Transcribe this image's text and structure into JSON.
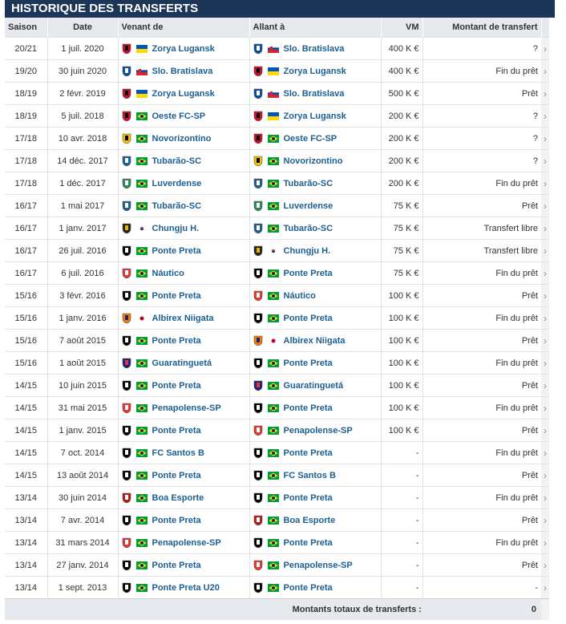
{
  "section": {
    "title": "Historique des transferts"
  },
  "columns": {
    "season": "Saison",
    "date": "Date",
    "from": "Venant de",
    "to": "Allant à",
    "vm": "VM",
    "fee": "Montant de transfert"
  },
  "rows": [
    {
      "season": "20/21",
      "date": "1 juil. 2020",
      "from": "Zorya Lugansk",
      "from_flag": "ua",
      "to": "Slo. Bratislava",
      "to_flag": "sk",
      "vm": "400 K €",
      "fee": "?"
    },
    {
      "season": "19/20",
      "date": "30 juin 2020",
      "from": "Slo. Bratislava",
      "from_flag": "sk",
      "to": "Zorya Lugansk",
      "to_flag": "ua",
      "vm": "400 K €",
      "fee": "Fin du prêt"
    },
    {
      "season": "18/19",
      "date": "2 févr. 2019",
      "from": "Zorya Lugansk",
      "from_flag": "ua",
      "to": "Slo. Bratislava",
      "to_flag": "sk",
      "vm": "500 K €",
      "fee": "Prêt"
    },
    {
      "season": "18/19",
      "date": "5 juil. 2018",
      "from": "Oeste FC-SP",
      "from_flag": "br",
      "to": "Zorya Lugansk",
      "to_flag": "ua",
      "vm": "200 K €",
      "fee": "?"
    },
    {
      "season": "17/18",
      "date": "10 avr. 2018",
      "from": "Novorizontino",
      "from_flag": "br",
      "to": "Oeste FC-SP",
      "to_flag": "br",
      "vm": "200 K €",
      "fee": "?"
    },
    {
      "season": "17/18",
      "date": "14 déc. 2017",
      "from": "Tubarão-SC",
      "from_flag": "br",
      "to": "Novorizontino",
      "to_flag": "br",
      "vm": "200 K €",
      "fee": "?"
    },
    {
      "season": "17/18",
      "date": "1 déc. 2017",
      "from": "Luverdense",
      "from_flag": "br",
      "to": "Tubarão-SC",
      "to_flag": "br",
      "vm": "200 K €",
      "fee": "Fin du prêt"
    },
    {
      "season": "16/17",
      "date": "1 mai 2017",
      "from": "Tubarão-SC",
      "from_flag": "br",
      "to": "Luverdense",
      "to_flag": "br",
      "vm": "75 K €",
      "fee": "Prêt"
    },
    {
      "season": "16/17",
      "date": "1 janv. 2017",
      "from": "Chungju H.",
      "from_flag": "kr",
      "to": "Tubarão-SC",
      "to_flag": "br",
      "vm": "75 K €",
      "fee": "Transfert libre"
    },
    {
      "season": "16/17",
      "date": "26 juil. 2016",
      "from": "Ponte Preta",
      "from_flag": "br",
      "to": "Chungju H.",
      "to_flag": "kr",
      "vm": "75 K €",
      "fee": "Transfert libre"
    },
    {
      "season": "16/17",
      "date": "6 juil. 2016",
      "from": "Náutico",
      "from_flag": "br",
      "to": "Ponte Preta",
      "to_flag": "br",
      "vm": "75 K €",
      "fee": "Fin du prêt"
    },
    {
      "season": "15/16",
      "date": "3 févr. 2016",
      "from": "Ponte Preta",
      "from_flag": "br",
      "to": "Náutico",
      "to_flag": "br",
      "vm": "100 K €",
      "fee": "Prêt"
    },
    {
      "season": "15/16",
      "date": "1 janv. 2016",
      "from": "Albirex Niigata",
      "from_flag": "jp",
      "to": "Ponte Preta",
      "to_flag": "br",
      "vm": "100 K €",
      "fee": "Fin du prêt"
    },
    {
      "season": "15/16",
      "date": "7 août 2015",
      "from": "Ponte Preta",
      "from_flag": "br",
      "to": "Albirex Niigata",
      "to_flag": "jp",
      "vm": "100 K €",
      "fee": "Prêt"
    },
    {
      "season": "15/16",
      "date": "1 août 2015",
      "from": "Guaratinguetá",
      "from_flag": "br",
      "to": "Ponte Preta",
      "to_flag": "br",
      "vm": "100 K €",
      "fee": "Fin du prêt"
    },
    {
      "season": "14/15",
      "date": "10 juin 2015",
      "from": "Ponte Preta",
      "from_flag": "br",
      "to": "Guaratinguetá",
      "to_flag": "br",
      "vm": "100 K €",
      "fee": "Prêt"
    },
    {
      "season": "14/15",
      "date": "31 mai 2015",
      "from": "Penapolense-SP",
      "from_flag": "br",
      "to": "Ponte Preta",
      "to_flag": "br",
      "vm": "100 K €",
      "fee": "Fin du prêt"
    },
    {
      "season": "14/15",
      "date": "1 janv. 2015",
      "from": "Ponte Preta",
      "from_flag": "br",
      "to": "Penapolense-SP",
      "to_flag": "br",
      "vm": "100 K €",
      "fee": "Prêt"
    },
    {
      "season": "14/15",
      "date": "7 oct. 2014",
      "from": "FC Santos B",
      "from_flag": "br",
      "to": "Ponte Preta",
      "to_flag": "br",
      "vm": "-",
      "fee": "Fin du prêt"
    },
    {
      "season": "14/15",
      "date": "13 août 2014",
      "from": "Ponte Preta",
      "from_flag": "br",
      "to": "FC Santos B",
      "to_flag": "br",
      "vm": "-",
      "fee": "Prêt"
    },
    {
      "season": "13/14",
      "date": "30 juin 2014",
      "from": "Boa Esporte",
      "from_flag": "br",
      "to": "Ponte Preta",
      "to_flag": "br",
      "vm": "-",
      "fee": "Fin du prêt"
    },
    {
      "season": "13/14",
      "date": "7 avr. 2014",
      "from": "Ponte Preta",
      "from_flag": "br",
      "to": "Boa Esporte",
      "to_flag": "br",
      "vm": "-",
      "fee": "Prêt"
    },
    {
      "season": "13/14",
      "date": "31 mars 2014",
      "from": "Penapolense-SP",
      "from_flag": "br",
      "to": "Ponte Preta",
      "to_flag": "br",
      "vm": "-",
      "fee": "Fin du prêt"
    },
    {
      "season": "13/14",
      "date": "27 janv. 2014",
      "from": "Ponte Preta",
      "from_flag": "br",
      "to": "Penapolense-SP",
      "to_flag": "br",
      "vm": "-",
      "fee": "Prêt"
    },
    {
      "season": "13/14",
      "date": "1 sept. 2013",
      "from": "Ponte Preta U20",
      "from_flag": "br",
      "to": "Ponte Preta",
      "to_flag": "br",
      "vm": "-",
      "fee": "-"
    }
  ],
  "footer": {
    "label": "Montants totaux de transferts :",
    "total": "0"
  },
  "colors": {
    "header_bg": "#1d3557",
    "link": "#1d5f91",
    "row_line": "#e2e2e2",
    "arrow": "#5a9bd5"
  },
  "icons": {
    "row_arrow": "chevron-right-icon",
    "club": "club-crest-icon",
    "nation": "country-flag-icon"
  }
}
